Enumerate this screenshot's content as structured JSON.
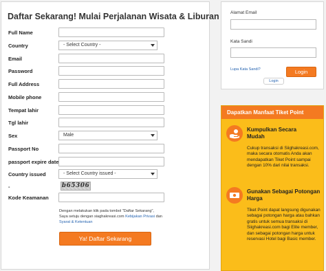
{
  "registration": {
    "title": "Daftar Sekarang! Mulai Perjalanan Wisata & Liburan Anda",
    "fields": {
      "full_name": "Full Name",
      "country": "Country",
      "email": "Email",
      "password": "Password",
      "full_address": "Full Address",
      "mobile_phone": "Mobile phone",
      "birth_place": "Tempat lahir",
      "birth_date": "Tgl lahir",
      "sex": "Sex",
      "passport_no": "Passport No",
      "passport_expire": "passport expire date",
      "country_issued": "Country issued",
      "dash": "-",
      "security_code": "Kode Keamanan"
    },
    "country_select": "- Select Country -",
    "sex_select": "Male",
    "country_issued_select": "- Select Country issued -",
    "captcha_text": "b65306",
    "terms": {
      "prefix": "Dengan melakukan klik pada tombol \"Daftar Sekarang\", Saya setuju dengan siaghakreasi.com",
      "privacy_link": "Kebijakan Privasi",
      "and": "dan",
      "terms_link": "Syarat & Ketentuan"
    },
    "submit_label": "Ya! Daftar Sekarang"
  },
  "login": {
    "email_label": "Alamat Email",
    "password_label": "Kata Sandi",
    "forgot_label": "Lupa Kata Sandi?",
    "login_button": "Login",
    "tab_label": "Login"
  },
  "benefits": {
    "header": "Dapatkan Manfaat Tiket Point",
    "items": [
      {
        "icon": "hand-coins-icon",
        "title": "Kumpulkan Secara Mudah",
        "text": "Cukup transaksi di Siighakreasi.com, maka secara otomatis Anda akan mendapatkan Tiket Point sampai dengan 10% dari nilai transaksi."
      },
      {
        "icon": "money-icon",
        "title": "Gunakan Sebagai Potongan Harga",
        "text": "Tiket Point dapat langsung digunakan sebagai potongan harga atau bahkan gratis untuk semua transaksi di Siighakreasi.com bagi Elite member, dan sebagai potongan harga untuk reservasi Hotel bagi Basic member."
      }
    ]
  },
  "colors": {
    "accent": "#f47a21",
    "benefit_bg": "#fbbd1a",
    "link": "#2563b0"
  }
}
